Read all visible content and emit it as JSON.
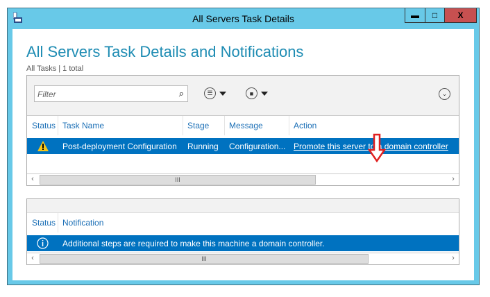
{
  "window": {
    "title": "All Servers Task Details",
    "minimize": "▬",
    "maximize": "□",
    "close": "X"
  },
  "page": {
    "heading": "All Servers Task Details and Notifications",
    "subtitle": "All Tasks | 1 total"
  },
  "tasks": {
    "filter_placeholder": "Filter",
    "columns": [
      "Status",
      "Task Name",
      "Stage",
      "Message",
      "Action"
    ],
    "rows": [
      {
        "status": "warning",
        "task_name": "Post-deployment Configuration",
        "stage": "Running",
        "message": "Configuration...",
        "action": "Promote this server to a domain controller"
      }
    ],
    "scroll_thumb": "III"
  },
  "notifications": {
    "columns": [
      "Status",
      "Notification"
    ],
    "rows": [
      {
        "status": "info",
        "notification": "Additional steps are required to make this machine a domain controller."
      }
    ],
    "scroll_thumb": "III"
  },
  "colors": {
    "titlebar": "#68c9e8",
    "selection": "#0072c0",
    "heading": "#1e8cb3",
    "annotation": "#e02020"
  }
}
